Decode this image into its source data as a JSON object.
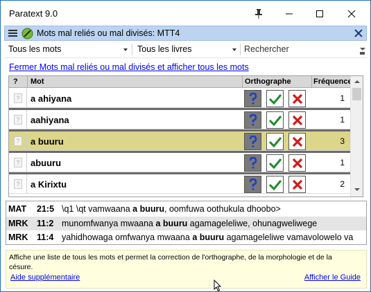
{
  "window": {
    "title": "Paratext 9.0"
  },
  "panel": {
    "title": "Mots mal reliés ou mal divisés: MTT4"
  },
  "filters": {
    "words": "Tous les mots",
    "books": "Tous les livres",
    "search_placeholder": "Rechercher"
  },
  "link_text": "Fermer Mots mal reliés ou mal divisés et afficher tous les mots",
  "grid": {
    "headers": {
      "q": "?",
      "word": "Mot",
      "spelling": "Orthographe",
      "freq": "Fréquence"
    },
    "rows": [
      {
        "word": "a ahiyana",
        "freq": "1",
        "selected": false
      },
      {
        "word": "aahiyana",
        "freq": "1",
        "selected": false
      },
      {
        "word": "a buuru",
        "freq": "3",
        "selected": true
      },
      {
        "word": "abuuru",
        "freq": "1",
        "selected": false
      },
      {
        "word": "a Kirixtu",
        "freq": "2",
        "selected": false
      }
    ]
  },
  "references": [
    {
      "book": "MAT",
      "cv": "21:5",
      "before": "\\q1 \\qt vamwaana ",
      "bold": "a buuru",
      "after": ", oomfuwa oothukula dhoobo>"
    },
    {
      "book": "MRK",
      "cv": "11:2",
      "before": "munomfwanya mwaana ",
      "bold": "a buuru",
      "after": " agamageleliwe, ohunagweliwege"
    },
    {
      "book": "MRK",
      "cv": "11:4",
      "before": "yahidhowaga omfwanya mwaana ",
      "bold": "a buuru",
      "after": " agamageleliwe vamavolowelo va"
    }
  ],
  "help": {
    "description": "Affiche une liste de tous les mots et permet la correction de l'orthographe, de la morphologie et de la césure.",
    "more_link": "Aide supplémentaire",
    "guide_link": "Afficher le Guide"
  },
  "colors": {
    "selected_row": "#dcd68a",
    "panel_header": "#bcd4f0",
    "help_bg": "#ffffe0"
  }
}
